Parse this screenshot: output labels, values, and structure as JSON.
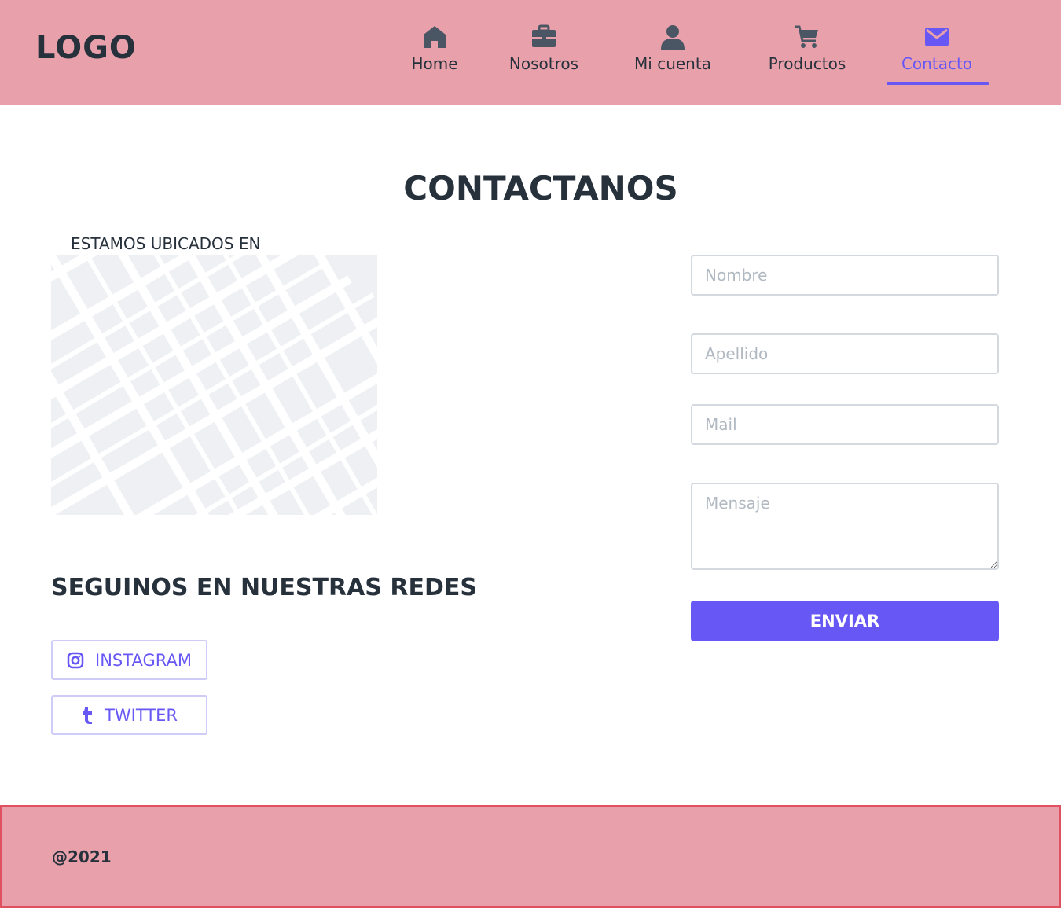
{
  "header": {
    "logo": "LOGO",
    "nav": [
      {
        "label": "Home",
        "icon": "home-icon"
      },
      {
        "label": "Nosotros",
        "icon": "briefcase-icon"
      },
      {
        "label": "Mi cuenta",
        "icon": "user-icon"
      },
      {
        "label": "Productos",
        "icon": "cart-icon"
      },
      {
        "label": "Contacto",
        "icon": "mail-icon",
        "active": true
      }
    ]
  },
  "main": {
    "title": "CONTACTANOS",
    "location_label": "ESTAMOS UBICADOS EN",
    "social": {
      "title": "SEGUINOS EN NUESTRAS REDES",
      "instagram": "INSTAGRAM",
      "twitter": "TWITTER"
    },
    "form": {
      "nombre_placeholder": "Nombre",
      "apellido_placeholder": "Apellido",
      "mail_placeholder": "Mail",
      "mensaje_placeholder": "Mensaje",
      "submit": "ENVIAR"
    }
  },
  "footer": {
    "text": "@2021"
  },
  "colors": {
    "header_bg": "#e8a1aa",
    "accent": "#6757f5",
    "text": "#27313c"
  }
}
